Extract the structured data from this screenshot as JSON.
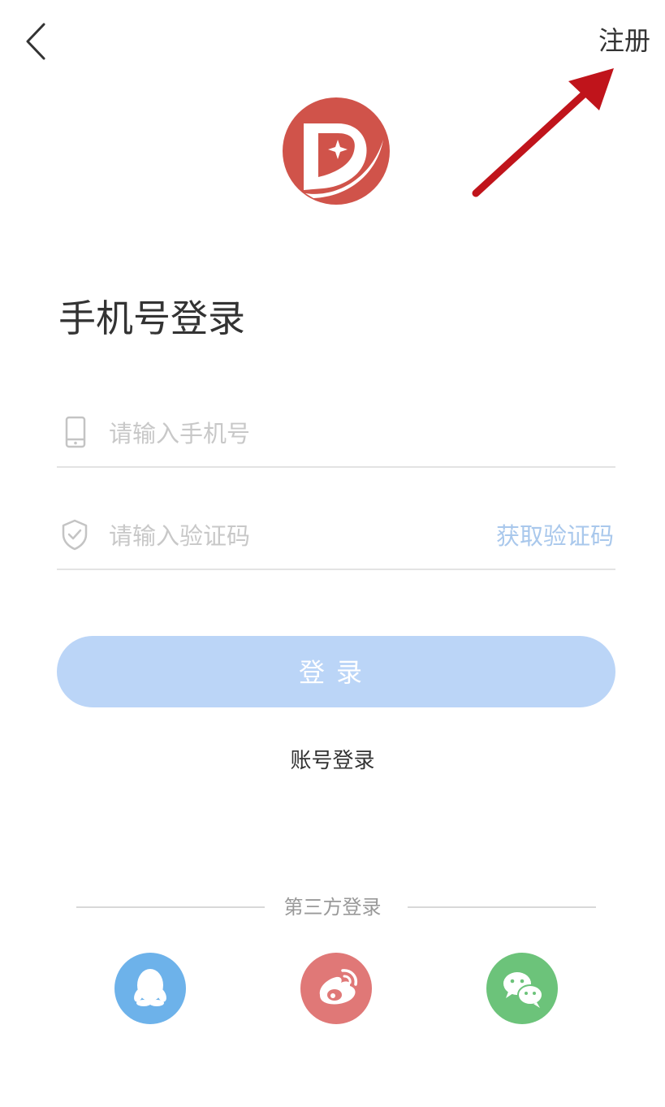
{
  "header": {
    "back_icon": "chevron-left-icon",
    "register_label": "注册"
  },
  "logo": {
    "icon": "app-logo",
    "colors": {
      "primary": "#d0534a"
    }
  },
  "title": "手机号登录",
  "form": {
    "phone": {
      "icon": "phone-icon",
      "placeholder": "请输入手机号",
      "value": ""
    },
    "code": {
      "icon": "shield-icon",
      "placeholder": "请输入验证码",
      "value": "",
      "get_code_label": "获取验证码"
    }
  },
  "login_button": {
    "label": "登录",
    "color": "#bbd5f7"
  },
  "account_login_label": "账号登录",
  "third_party": {
    "label": "第三方登录",
    "providers": [
      {
        "icon": "qq-icon",
        "color": "#6db2ea"
      },
      {
        "icon": "weibo-icon",
        "color": "#e07877"
      },
      {
        "icon": "wechat-icon",
        "color": "#6cc37a"
      }
    ]
  },
  "annotation": {
    "icon": "red-arrow-icon",
    "color": "#c0141b"
  }
}
